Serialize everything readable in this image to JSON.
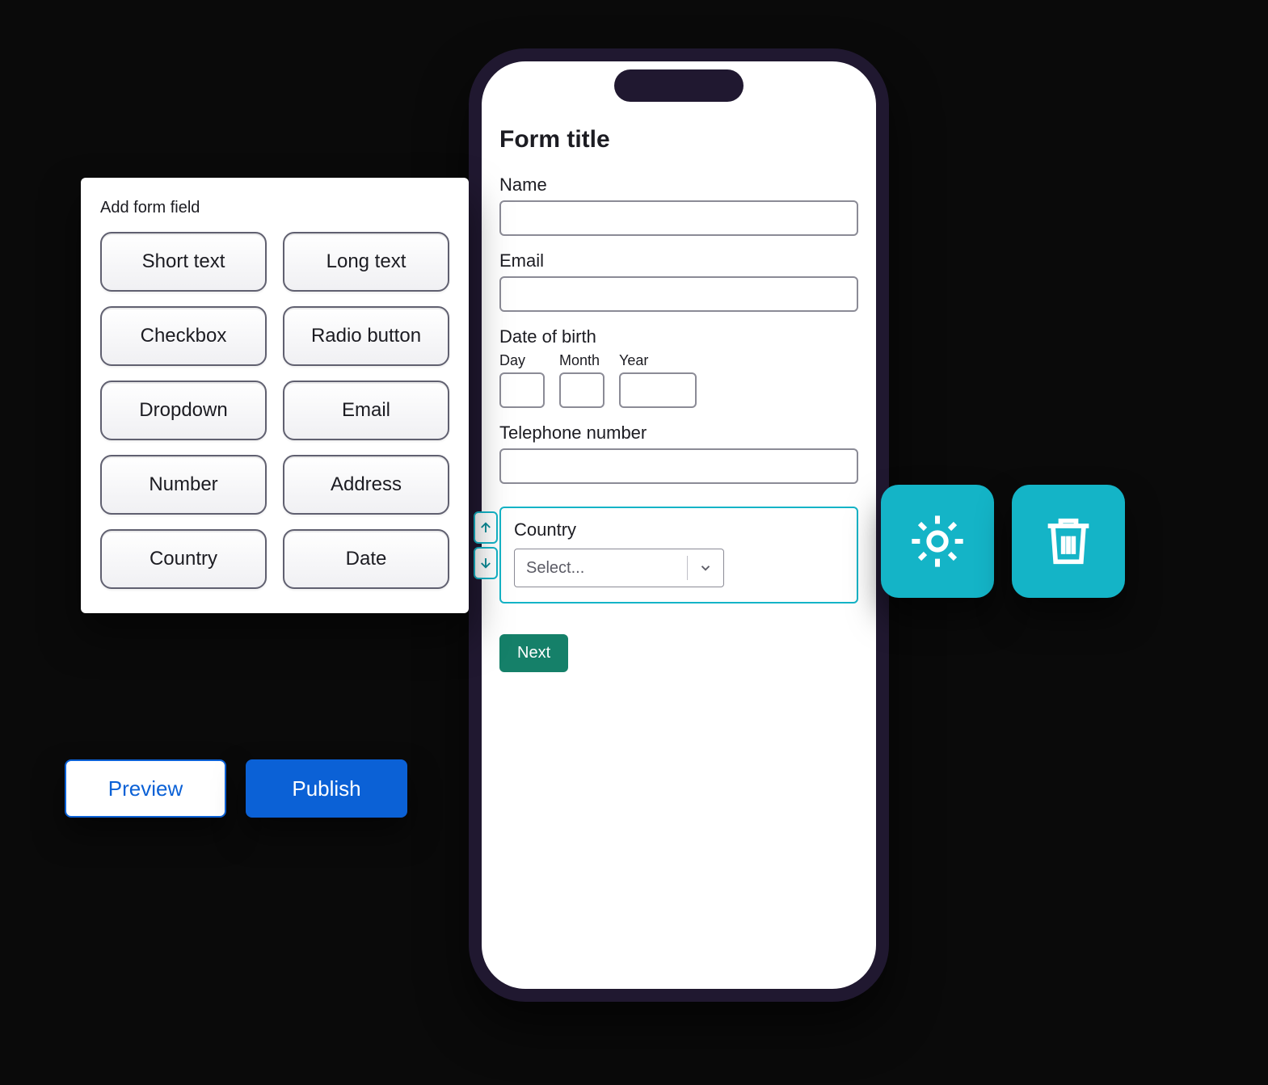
{
  "palette": {
    "title": "Add form field",
    "items": [
      {
        "label": "Short text",
        "name": "short-text"
      },
      {
        "label": "Long text",
        "name": "long-text"
      },
      {
        "label": "Checkbox",
        "name": "checkbox"
      },
      {
        "label": "Radio button",
        "name": "radio-button"
      },
      {
        "label": "Dropdown",
        "name": "dropdown"
      },
      {
        "label": "Email",
        "name": "email"
      },
      {
        "label": "Number",
        "name": "number"
      },
      {
        "label": "Address",
        "name": "address"
      },
      {
        "label": "Country",
        "name": "country"
      },
      {
        "label": "Date",
        "name": "date"
      }
    ]
  },
  "actions": {
    "preview": "Preview",
    "publish": "Publish"
  },
  "form": {
    "title": "Form title",
    "name_label": "Name",
    "email_label": "Email",
    "dob_label": "Date of birth",
    "dob_day": "Day",
    "dob_month": "Month",
    "dob_year": "Year",
    "telephone_label": "Telephone number",
    "country_label": "Country",
    "select_placeholder": "Select...",
    "next": "Next"
  },
  "float": {
    "settings": "settings",
    "delete": "delete"
  }
}
